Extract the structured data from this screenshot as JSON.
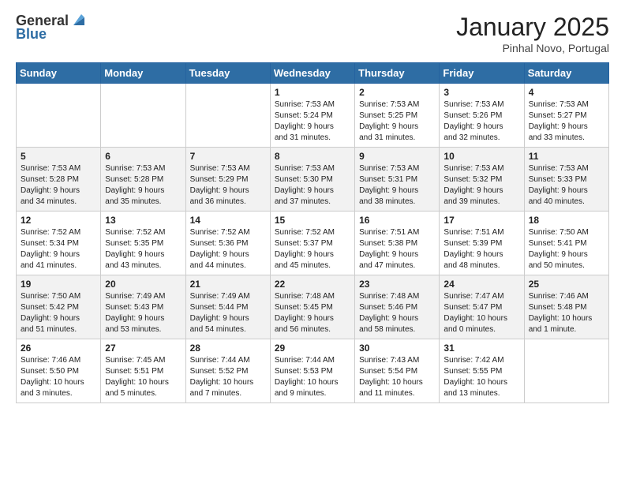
{
  "header": {
    "logo_general": "General",
    "logo_blue": "Blue",
    "title": "January 2025",
    "subtitle": "Pinhal Novo, Portugal"
  },
  "days_of_week": [
    "Sunday",
    "Monday",
    "Tuesday",
    "Wednesday",
    "Thursday",
    "Friday",
    "Saturday"
  ],
  "weeks": [
    [
      {
        "day": "",
        "info": ""
      },
      {
        "day": "",
        "info": ""
      },
      {
        "day": "",
        "info": ""
      },
      {
        "day": "1",
        "info": "Sunrise: 7:53 AM\nSunset: 5:24 PM\nDaylight: 9 hours\nand 31 minutes."
      },
      {
        "day": "2",
        "info": "Sunrise: 7:53 AM\nSunset: 5:25 PM\nDaylight: 9 hours\nand 31 minutes."
      },
      {
        "day": "3",
        "info": "Sunrise: 7:53 AM\nSunset: 5:26 PM\nDaylight: 9 hours\nand 32 minutes."
      },
      {
        "day": "4",
        "info": "Sunrise: 7:53 AM\nSunset: 5:27 PM\nDaylight: 9 hours\nand 33 minutes."
      }
    ],
    [
      {
        "day": "5",
        "info": "Sunrise: 7:53 AM\nSunset: 5:28 PM\nDaylight: 9 hours\nand 34 minutes."
      },
      {
        "day": "6",
        "info": "Sunrise: 7:53 AM\nSunset: 5:28 PM\nDaylight: 9 hours\nand 35 minutes."
      },
      {
        "day": "7",
        "info": "Sunrise: 7:53 AM\nSunset: 5:29 PM\nDaylight: 9 hours\nand 36 minutes."
      },
      {
        "day": "8",
        "info": "Sunrise: 7:53 AM\nSunset: 5:30 PM\nDaylight: 9 hours\nand 37 minutes."
      },
      {
        "day": "9",
        "info": "Sunrise: 7:53 AM\nSunset: 5:31 PM\nDaylight: 9 hours\nand 38 minutes."
      },
      {
        "day": "10",
        "info": "Sunrise: 7:53 AM\nSunset: 5:32 PM\nDaylight: 9 hours\nand 39 minutes."
      },
      {
        "day": "11",
        "info": "Sunrise: 7:53 AM\nSunset: 5:33 PM\nDaylight: 9 hours\nand 40 minutes."
      }
    ],
    [
      {
        "day": "12",
        "info": "Sunrise: 7:52 AM\nSunset: 5:34 PM\nDaylight: 9 hours\nand 41 minutes."
      },
      {
        "day": "13",
        "info": "Sunrise: 7:52 AM\nSunset: 5:35 PM\nDaylight: 9 hours\nand 43 minutes."
      },
      {
        "day": "14",
        "info": "Sunrise: 7:52 AM\nSunset: 5:36 PM\nDaylight: 9 hours\nand 44 minutes."
      },
      {
        "day": "15",
        "info": "Sunrise: 7:52 AM\nSunset: 5:37 PM\nDaylight: 9 hours\nand 45 minutes."
      },
      {
        "day": "16",
        "info": "Sunrise: 7:51 AM\nSunset: 5:38 PM\nDaylight: 9 hours\nand 47 minutes."
      },
      {
        "day": "17",
        "info": "Sunrise: 7:51 AM\nSunset: 5:39 PM\nDaylight: 9 hours\nand 48 minutes."
      },
      {
        "day": "18",
        "info": "Sunrise: 7:50 AM\nSunset: 5:41 PM\nDaylight: 9 hours\nand 50 minutes."
      }
    ],
    [
      {
        "day": "19",
        "info": "Sunrise: 7:50 AM\nSunset: 5:42 PM\nDaylight: 9 hours\nand 51 minutes."
      },
      {
        "day": "20",
        "info": "Sunrise: 7:49 AM\nSunset: 5:43 PM\nDaylight: 9 hours\nand 53 minutes."
      },
      {
        "day": "21",
        "info": "Sunrise: 7:49 AM\nSunset: 5:44 PM\nDaylight: 9 hours\nand 54 minutes."
      },
      {
        "day": "22",
        "info": "Sunrise: 7:48 AM\nSunset: 5:45 PM\nDaylight: 9 hours\nand 56 minutes."
      },
      {
        "day": "23",
        "info": "Sunrise: 7:48 AM\nSunset: 5:46 PM\nDaylight: 9 hours\nand 58 minutes."
      },
      {
        "day": "24",
        "info": "Sunrise: 7:47 AM\nSunset: 5:47 PM\nDaylight: 10 hours\nand 0 minutes."
      },
      {
        "day": "25",
        "info": "Sunrise: 7:46 AM\nSunset: 5:48 PM\nDaylight: 10 hours\nand 1 minute."
      }
    ],
    [
      {
        "day": "26",
        "info": "Sunrise: 7:46 AM\nSunset: 5:50 PM\nDaylight: 10 hours\nand 3 minutes."
      },
      {
        "day": "27",
        "info": "Sunrise: 7:45 AM\nSunset: 5:51 PM\nDaylight: 10 hours\nand 5 minutes."
      },
      {
        "day": "28",
        "info": "Sunrise: 7:44 AM\nSunset: 5:52 PM\nDaylight: 10 hours\nand 7 minutes."
      },
      {
        "day": "29",
        "info": "Sunrise: 7:44 AM\nSunset: 5:53 PM\nDaylight: 10 hours\nand 9 minutes."
      },
      {
        "day": "30",
        "info": "Sunrise: 7:43 AM\nSunset: 5:54 PM\nDaylight: 10 hours\nand 11 minutes."
      },
      {
        "day": "31",
        "info": "Sunrise: 7:42 AM\nSunset: 5:55 PM\nDaylight: 10 hours\nand 13 minutes."
      },
      {
        "day": "",
        "info": ""
      }
    ]
  ]
}
